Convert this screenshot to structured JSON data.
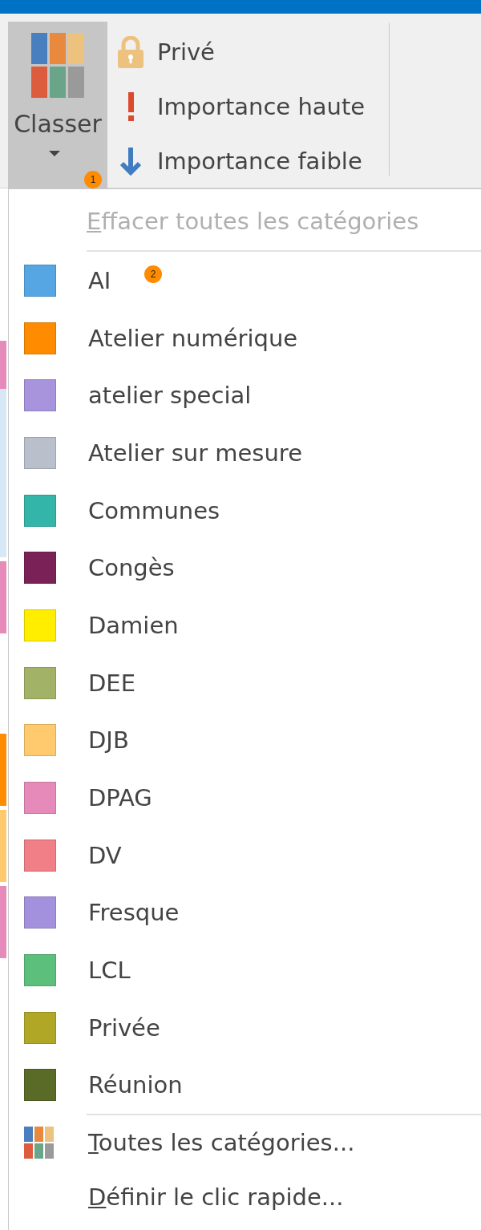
{
  "ribbon": {
    "classer": {
      "label": "Classer",
      "badge": "1"
    },
    "items": [
      {
        "kind": "lock",
        "label": "Privé"
      },
      {
        "kind": "high",
        "label": "Importance haute"
      },
      {
        "kind": "low",
        "label": "Importance faible"
      }
    ]
  },
  "menu": {
    "clear": {
      "label": "Effacer toutes les catégories",
      "disabled": true
    },
    "badge": "2",
    "categories": [
      {
        "name": "AI",
        "color": "#55a6e3"
      },
      {
        "name": "Atelier numérique",
        "color": "#ff8c00"
      },
      {
        "name": "atelier special",
        "color": "#a794dd"
      },
      {
        "name": "Atelier sur mesure",
        "color": "#b9c0cb"
      },
      {
        "name": "Communes",
        "color": "#33b5aa"
      },
      {
        "name": "Congès",
        "color": "#7a2258"
      },
      {
        "name": "Damien",
        "color": "#ffee00"
      },
      {
        "name": "DEE",
        "color": "#a2b367"
      },
      {
        "name": "DJB",
        "color": "#ffc96e"
      },
      {
        "name": "DPAG",
        "color": "#e68bb9"
      },
      {
        "name": "DV",
        "color": "#f07f87"
      },
      {
        "name": "Fresque",
        "color": "#a491dd"
      },
      {
        "name": "LCL",
        "color": "#5cbf7c"
      },
      {
        "name": "Privée",
        "color": "#b1a727"
      },
      {
        "name": "Réunion",
        "color": "#5a6a27"
      }
    ],
    "footer": [
      {
        "kind": "all",
        "label": "Toutes les catégories..."
      },
      {
        "kind": "quick",
        "label": "Définir le clic rapide..."
      }
    ]
  }
}
